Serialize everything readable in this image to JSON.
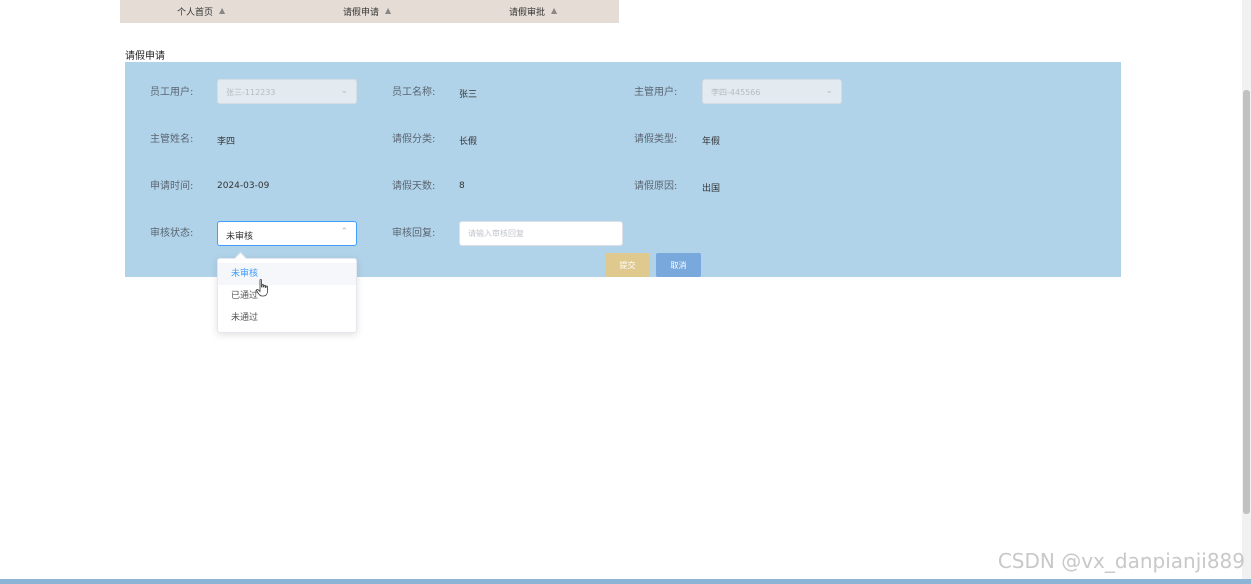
{
  "nav": {
    "items": [
      {
        "label": "个人首页"
      },
      {
        "label": "请假申请"
      },
      {
        "label": "请假审批"
      }
    ]
  },
  "page": {
    "title": "请假申请"
  },
  "form": {
    "employee_user": {
      "label": "员工用户:",
      "value": "张三-112233"
    },
    "employee_name": {
      "label": "员工名称:",
      "value": "张三"
    },
    "manager_user": {
      "label": "主管用户:",
      "value": "李四-445566"
    },
    "manager_name": {
      "label": "主管姓名:",
      "value": "李四"
    },
    "leave_category": {
      "label": "请假分类:",
      "value": "长假"
    },
    "leave_type": {
      "label": "请假类型:",
      "value": "年假"
    },
    "apply_time": {
      "label": "申请时间:",
      "value": "2024-03-09"
    },
    "leave_days": {
      "label": "请假天数:",
      "value": "8"
    },
    "leave_reason": {
      "label": "请假原因:",
      "value": "出国"
    },
    "review_status": {
      "label": "审核状态:",
      "value": "未审核",
      "options": [
        "未审核",
        "已通过",
        "未通过"
      ],
      "selected_index": 0
    },
    "review_reply": {
      "label": "审核回复:",
      "value": "",
      "placeholder": "请输入审核回复"
    },
    "submit_label": "提交",
    "cancel_label": "取消"
  },
  "watermark": "CSDN @vx_danpianji889",
  "colors": {
    "panel_bg": "#b1d3ea",
    "nav_bg": "#e5ddd5",
    "submit_bg": "#e0c98f",
    "cancel_bg": "#79a8dd",
    "accent": "#409eff"
  }
}
